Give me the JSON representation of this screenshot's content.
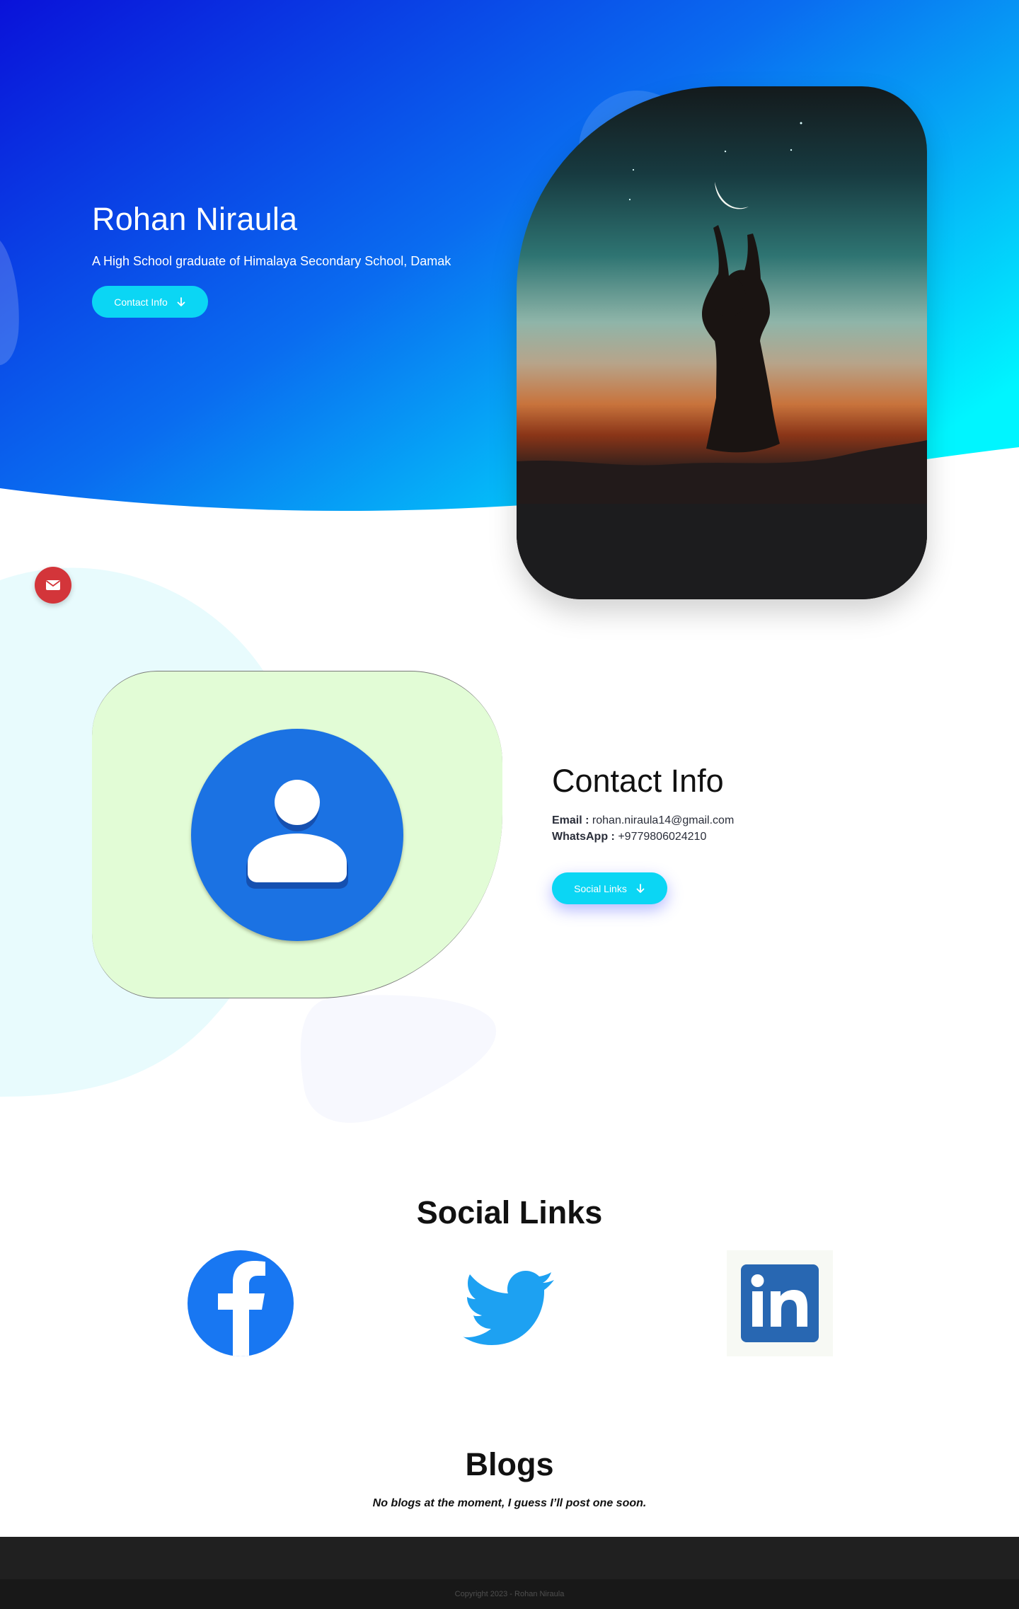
{
  "hero": {
    "name": "Rohan Niraula",
    "subtitle": "A High School graduate of Himalaya Secondary School, Damak",
    "button_label": "Contact Info"
  },
  "contact": {
    "title": "Contact Info",
    "email_label": "Email :",
    "email_value": "rohan.niraula14@gmail.com",
    "whatsapp_label": "WhatsApp :",
    "whatsapp_value": "+9779806024210",
    "button_label": "Social Links"
  },
  "social": {
    "title": "Social Links",
    "links": [
      {
        "name": "facebook",
        "icon": "facebook-icon"
      },
      {
        "name": "twitter",
        "icon": "twitter-icon"
      },
      {
        "name": "linkedin",
        "icon": "linkedin-icon"
      }
    ]
  },
  "blogs": {
    "title": "Blogs",
    "note": "No blogs at the moment, I guess I’ll post one soon."
  },
  "footer": {
    "copyright": "Copyright 2023 - Rohan Niraula"
  },
  "colors": {
    "accent": "#0bd6f4",
    "hero_gradient_start": "#0a12d9",
    "hero_gradient_end": "#00f0ff",
    "mail_button": "#d3353a",
    "avatar_blue": "#1b72e3",
    "facebook": "#1877f2",
    "twitter": "#1da1f2",
    "linkedin": "#2867b2"
  }
}
